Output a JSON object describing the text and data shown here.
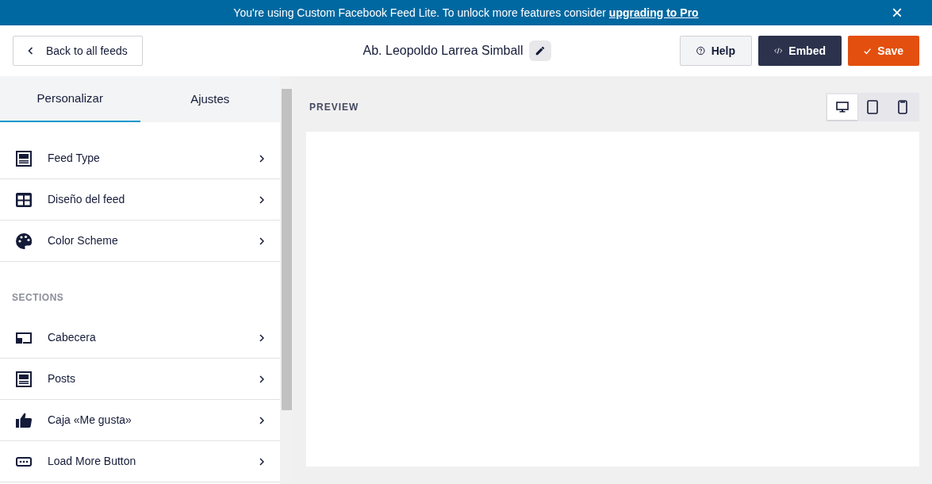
{
  "banner": {
    "text": "You're using Custom Facebook Feed Lite. To unlock more features consider",
    "link": "upgrading to Pro",
    "close": "×"
  },
  "header": {
    "back": "Back to all feeds",
    "title": "Ab. Leopoldo Larrea Simball",
    "buttons": [
      {
        "kind": "help",
        "label": "Help"
      },
      {
        "kind": "embed",
        "label": "Embed"
      },
      {
        "kind": "save",
        "label": "Save"
      }
    ]
  },
  "tabs": [
    {
      "label": "Personalizar",
      "selected": true
    },
    {
      "label": "Ajustes",
      "selected": false
    }
  ],
  "menu": [
    {
      "kind": "post",
      "label": "Feed Type"
    },
    {
      "kind": "grid",
      "label": "Diseño del feed"
    },
    {
      "kind": "palette",
      "label": "Color Scheme"
    }
  ],
  "sections": {
    "heading": "SECTIONS",
    "items": [
      {
        "kind": "header",
        "label": "Cabecera"
      },
      {
        "kind": "post",
        "label": "Posts"
      },
      {
        "kind": "thumb",
        "label": "Caja «Me gusta»"
      },
      {
        "kind": "dots",
        "label": "Load More Button"
      }
    ]
  },
  "preview": {
    "heading": "PREVIEW",
    "devices": [
      {
        "kind": "desktop",
        "selected": true
      },
      {
        "kind": "tablet",
        "selected": false
      },
      {
        "kind": "phone",
        "selected": false
      }
    ]
  }
}
